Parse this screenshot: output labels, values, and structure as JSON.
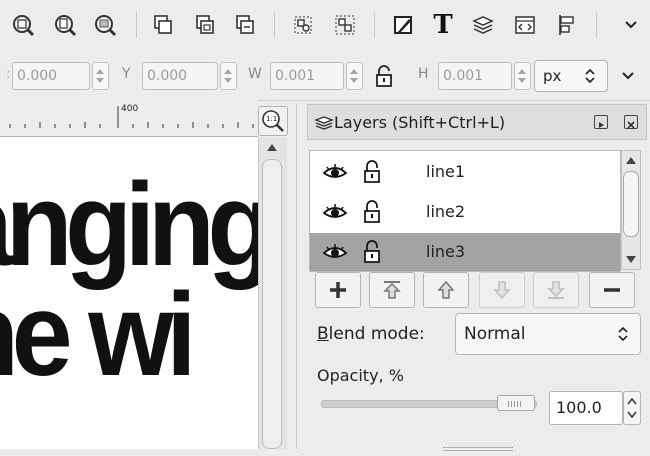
{
  "toolbar": {
    "icons": [
      "zoom-drawing-icon",
      "zoom-page-icon",
      "zoom-width-icon",
      "duplicate-icon",
      "clone-icon",
      "unlink-clone-icon",
      "group-icon",
      "ungroup-icon",
      "fill-stroke-icon",
      "text-tool-icon",
      "layers-icon",
      "xml-editor-icon",
      "align-icon"
    ],
    "more_icon": "chevron-down-icon"
  },
  "coords": {
    "x_value": "0.000",
    "y_label": "Y",
    "y_value": "0.000",
    "w_label": "W",
    "w_value": "0.001",
    "h_label": "H",
    "h_value": "0.001",
    "unit": "px"
  },
  "ruler": {
    "mark": "400",
    "zoom_button": "1:1"
  },
  "canvas": {
    "line1": "anging",
    "line2": "ne wi"
  },
  "layers_panel": {
    "title": "Layers (Shift+Ctrl+L)",
    "layers": [
      {
        "name": "line1",
        "visible": true,
        "locked": false,
        "selected": false
      },
      {
        "name": "line2",
        "visible": true,
        "locked": false,
        "selected": false
      },
      {
        "name": "line3",
        "visible": true,
        "locked": false,
        "selected": true
      }
    ],
    "blend_label_underlined": "B",
    "blend_label_rest": "lend mode:",
    "blend_value": "Normal",
    "opacity_label": "Opacity, %",
    "opacity_value": "100.0",
    "opacity_fraction": 1.0
  }
}
